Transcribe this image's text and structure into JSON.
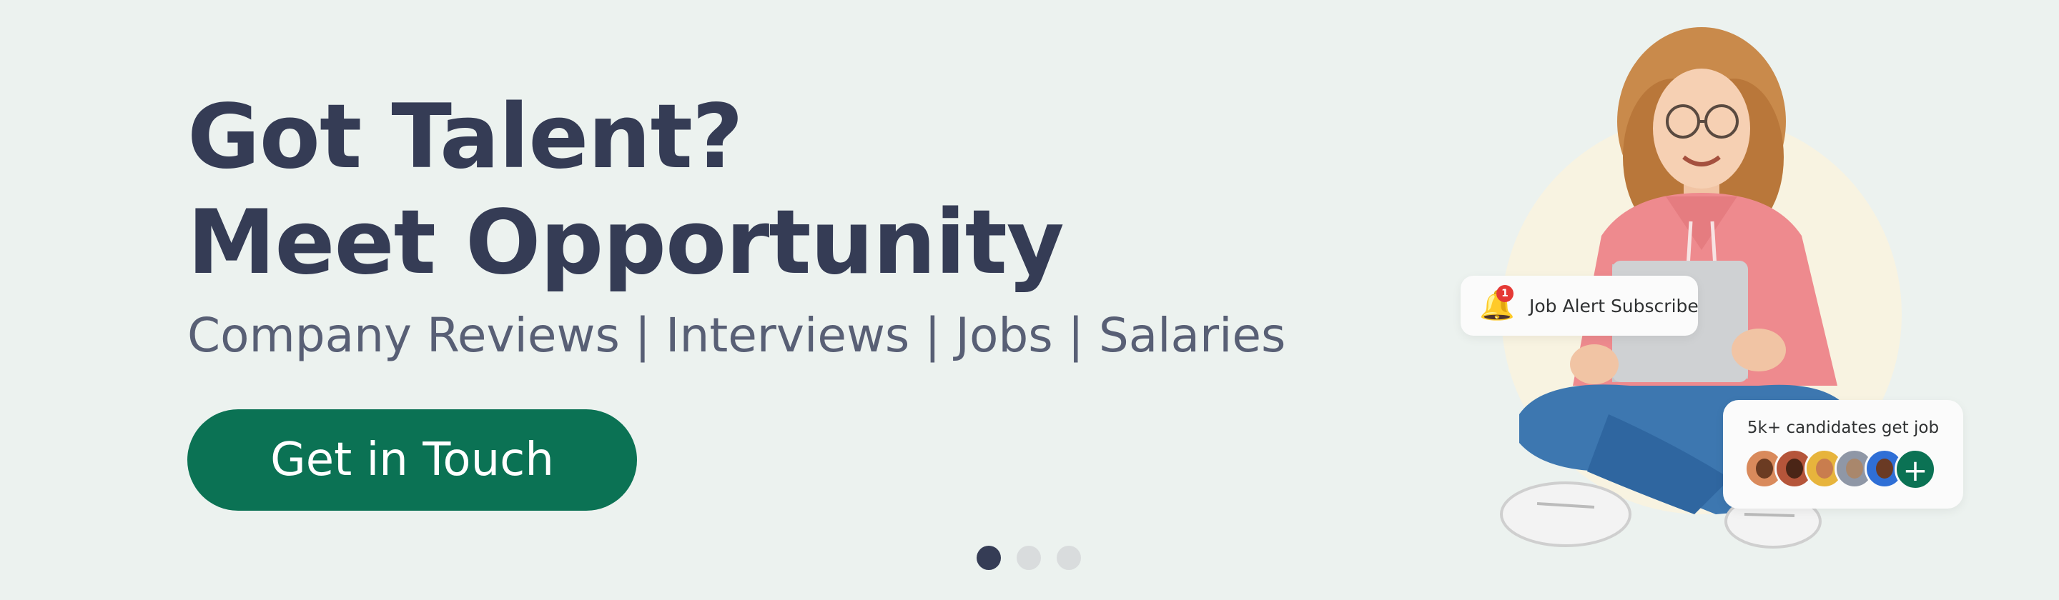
{
  "hero": {
    "headline_line1": "Got Talent?",
    "headline_line2": "Meet Opportunity",
    "subtitle": "Company Reviews | Interviews | Jobs | Salaries",
    "cta_label": "Get in Touch"
  },
  "carousel": {
    "slide_count": 3,
    "active_index": 0
  },
  "badges": {
    "job_alert": {
      "label": "Job Alert Subscribe",
      "notification_count": "1",
      "icon": "bell-icon"
    },
    "candidates": {
      "label": "5k+ candidates get job",
      "more_symbol": "+",
      "avatar_colors": [
        "#d98a5c",
        "#b5553a",
        "#e7b43c",
        "#8f97a6",
        "#2f6fd6"
      ]
    }
  },
  "colors": {
    "background": "#ecf2ef",
    "headline": "#353c55",
    "subtitle": "#585f75",
    "accent": "#0b7254",
    "dot_active": "#353c55",
    "dot_inactive": "#d9dcdd"
  }
}
